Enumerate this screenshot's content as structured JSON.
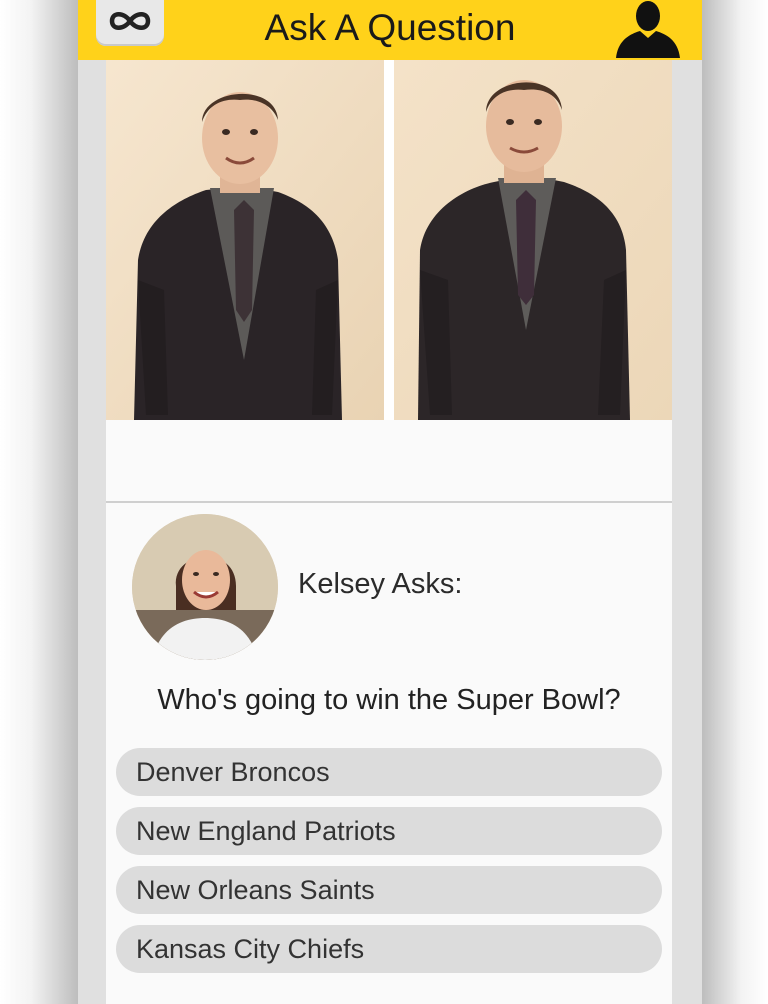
{
  "header": {
    "title": "Ask A Question",
    "menu_icon": "infinity-icon",
    "profile_icon": "user-silhouette-icon",
    "accent_color": "#ffd21a"
  },
  "photos": [
    {
      "name": "photo-option-1",
      "desc_icon": "photo"
    },
    {
      "name": "photo-option-2",
      "desc_icon": "photo"
    }
  ],
  "asker": {
    "label": "Kelsey Asks:"
  },
  "question": {
    "text": "Who's going to win the Super Bowl?"
  },
  "options": [
    {
      "label": "Denver Broncos"
    },
    {
      "label": "New England Patriots"
    },
    {
      "label": "New Orleans Saints"
    },
    {
      "label": "Kansas City Chiefs"
    }
  ]
}
